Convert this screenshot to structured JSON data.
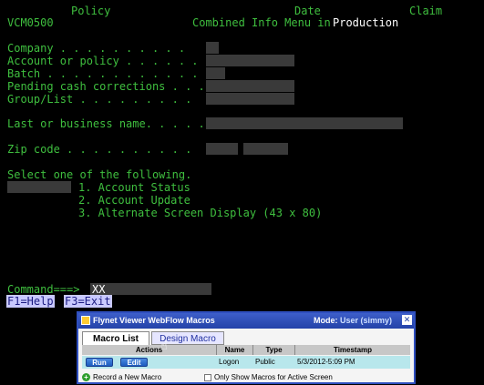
{
  "header": {
    "policy": "Policy",
    "date": "Date",
    "claim": "Claim",
    "screen_id": "VCM0500",
    "title": "Combined Info Menu in",
    "environment": "Production"
  },
  "fields": {
    "company": "Company . . . . . . . . . .",
    "account": "Account or policy . . . . . .",
    "batch": "Batch . . . . . . . . . . . .",
    "pending": "Pending cash corrections . . .",
    "group": "Group/List . . . . . . . . .",
    "lastname": "Last or business name. . . . .",
    "zip": "Zip code . . . . . . . . . ."
  },
  "menu": {
    "prompt": "Select one of the following.",
    "options": [
      "1. Account Status",
      "2. Account Update",
      "3. Alternate Screen Display (43 x 80)"
    ]
  },
  "command": {
    "label": "Command===>",
    "value": "XX"
  },
  "fkeys": {
    "f1": "F1=Help",
    "f3": "F3=Exit"
  },
  "macro_panel": {
    "title": "Flynet Viewer WebFlow Macros",
    "mode_label": "Mode:",
    "mode_value": "User (simmy)",
    "close": "✕",
    "tabs": [
      "Macro List",
      "Design Macro"
    ],
    "columns": [
      "Actions",
      "Name",
      "Type",
      "Timestamp"
    ],
    "rows": [
      {
        "run": "Run",
        "edit": "Edit",
        "name": "Logon",
        "type": "Public",
        "timestamp": "5/3/2012-5:09 PM"
      }
    ],
    "record_new": "Record a New Macro",
    "only_show": "Only Show Macros for Active Screen"
  }
}
